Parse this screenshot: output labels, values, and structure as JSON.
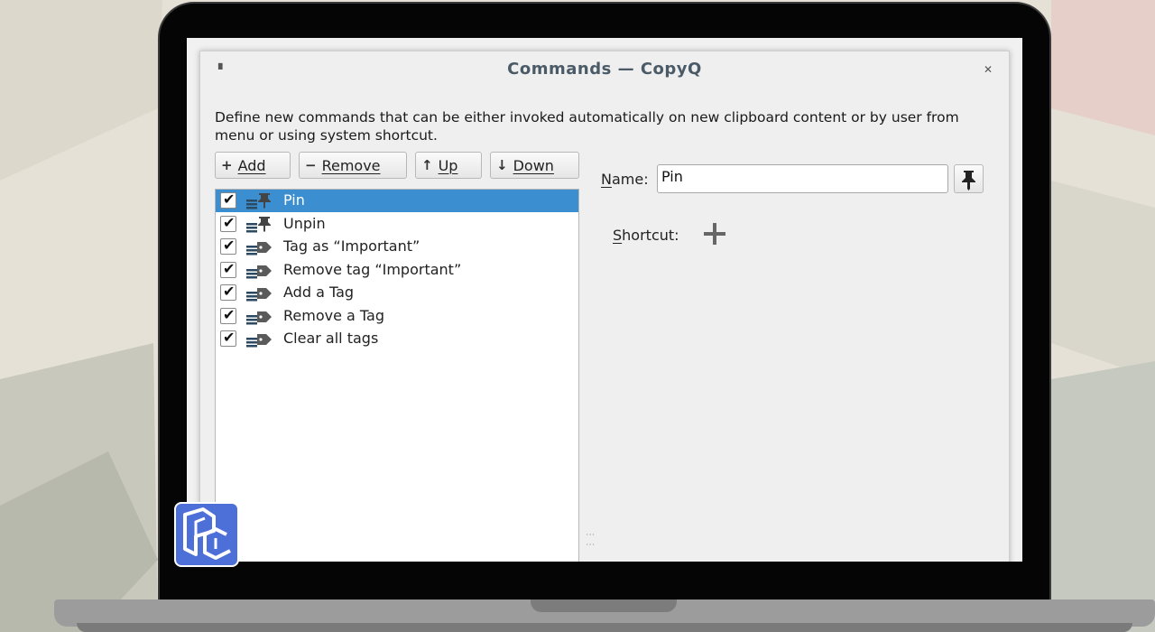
{
  "window": {
    "title": "Commands — CopyQ"
  },
  "description": "Define new commands that can be either invoked automatically on new clipboard content or by user from menu or using system shortcut.",
  "toolbar": [
    {
      "icon": "plus-icon",
      "glyph": "+",
      "label": "Add"
    },
    {
      "icon": "minus-icon",
      "glyph": "−",
      "label": "Remove"
    },
    {
      "icon": "arrow-up-icon",
      "glyph": "↑",
      "label": "Up"
    },
    {
      "icon": "arrow-down-icon",
      "glyph": "↓",
      "label": "Down"
    }
  ],
  "commands": [
    {
      "label": "Pin",
      "checked": true,
      "icon": "pin-icon",
      "selected": true
    },
    {
      "label": "Unpin",
      "checked": true,
      "icon": "pin-icon"
    },
    {
      "label": "Tag as “Important”",
      "checked": true,
      "icon": "tag-icon"
    },
    {
      "label": "Remove tag “Important”",
      "checked": true,
      "icon": "tag-icon"
    },
    {
      "label": "Add a Tag",
      "checked": true,
      "icon": "tag-icon"
    },
    {
      "label": "Remove a Tag",
      "checked": true,
      "icon": "tag-icon"
    },
    {
      "label": "Clear all tags",
      "checked": true,
      "icon": "tag-icon"
    }
  ],
  "form": {
    "name_label": "Name:",
    "name_value": "Pin",
    "shortcut_label": "Shortcut:"
  },
  "colors": {
    "selection": "#3b8fd0",
    "title_text": "#4a5a66"
  }
}
